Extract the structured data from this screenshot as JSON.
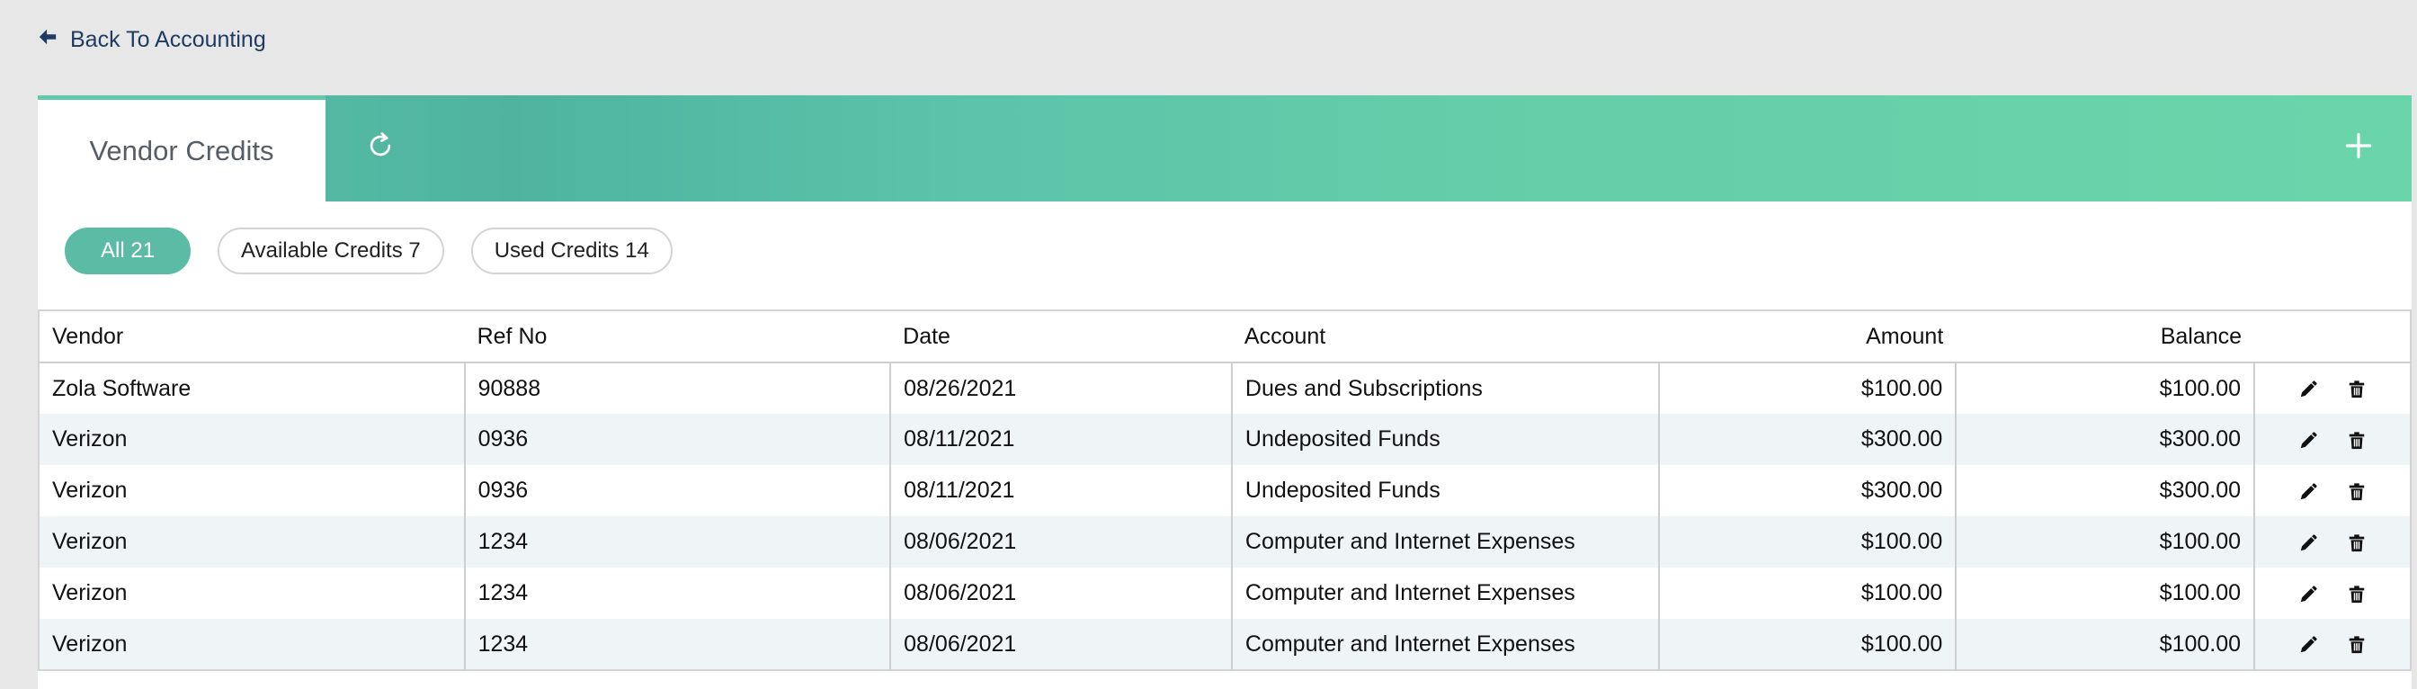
{
  "nav": {
    "back_label": "Back To Accounting"
  },
  "header": {
    "tab_label": "Vendor Credits"
  },
  "filters": [
    {
      "label": "All 21",
      "active": true
    },
    {
      "label": "Available Credits 7",
      "active": false
    },
    {
      "label": "Used Credits 14",
      "active": false
    }
  ],
  "table": {
    "columns": [
      "Vendor",
      "Ref No",
      "Date",
      "Account",
      "Amount",
      "Balance"
    ],
    "rows": [
      [
        "Zola Software",
        "90888",
        "08/26/2021",
        "Dues and Subscriptions",
        "$100.00",
        "$100.00"
      ],
      [
        "Verizon",
        "0936",
        "08/11/2021",
        "Undeposited Funds",
        "$300.00",
        "$300.00"
      ],
      [
        "Verizon",
        "0936",
        "08/11/2021",
        "Undeposited Funds",
        "$300.00",
        "$300.00"
      ],
      [
        "Verizon",
        "1234",
        "08/06/2021",
        "Computer and Internet Expenses",
        "$100.00",
        "$100.00"
      ],
      [
        "Verizon",
        "1234",
        "08/06/2021",
        "Computer and Internet Expenses",
        "$100.00",
        "$100.00"
      ],
      [
        "Verizon",
        "1234",
        "08/06/2021",
        "Computer and Internet Expenses",
        "$100.00",
        "$100.00"
      ]
    ]
  },
  "colors": {
    "accent": "#5cbba4",
    "nav_text": "#1f3b63",
    "row_stripe": "#eff4f7"
  },
  "icons": {
    "back": "arrow-left-icon",
    "refresh": "refresh-icon",
    "add": "plus-icon",
    "edit": "pencil-icon",
    "delete": "trash-icon"
  }
}
